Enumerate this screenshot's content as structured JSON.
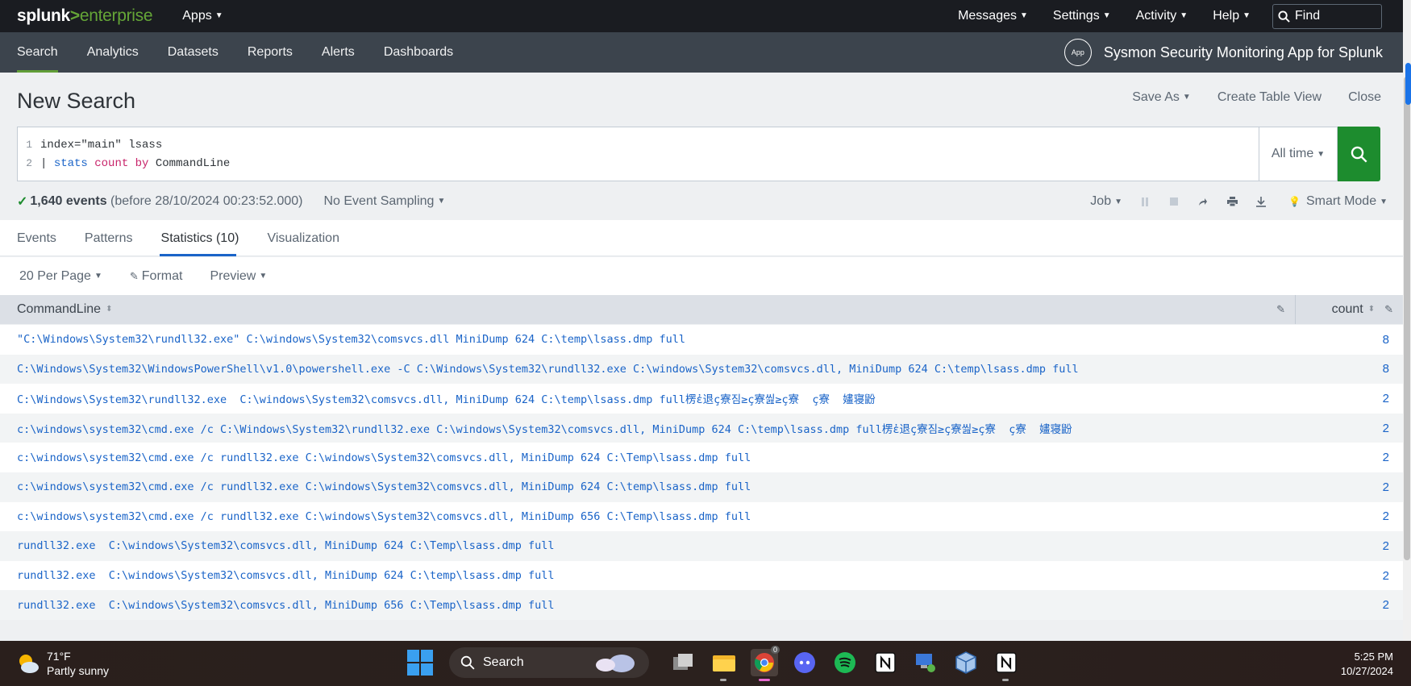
{
  "topbar": {
    "logo_brand": "splunk",
    "logo_sep": ">",
    "logo_product": "enterprise",
    "apps_label": "Apps",
    "links": [
      "Messages",
      "Settings",
      "Activity",
      "Help"
    ],
    "find_placeholder": "Find"
  },
  "appnav": {
    "items": [
      "Search",
      "Analytics",
      "Datasets",
      "Reports",
      "Alerts",
      "Dashboards"
    ],
    "active": "Search",
    "app_icon_text": "App",
    "app_title": "Sysmon Security Monitoring App for Splunk"
  },
  "page": {
    "title": "New Search",
    "actions": {
      "save_as": "Save As",
      "create_table_view": "Create Table View",
      "close": "Close"
    }
  },
  "search": {
    "line1_no": "1",
    "line2_no": "2",
    "line1": "index=\"main\" lsass",
    "line2_pipe": "| ",
    "line2_cmd": "stats",
    "line2_func": "count",
    "line2_by": "by",
    "line2_field": "CommandLine",
    "time_range": "All time"
  },
  "status": {
    "check": "✓",
    "events": "1,640 events",
    "before": "(before 28/10/2024 00:23:52.000)",
    "sampling": "No Event Sampling",
    "job": "Job",
    "mode": "Smart Mode"
  },
  "tabs": {
    "events": "Events",
    "patterns": "Patterns",
    "statistics": "Statistics (10)",
    "visualization": "Visualization"
  },
  "toolbar": {
    "per_page": "20 Per Page",
    "format": "Format",
    "preview": "Preview"
  },
  "table": {
    "col_command": "CommandLine",
    "col_count": "count",
    "rows": [
      {
        "cmd": "\"C:\\Windows\\System32\\rundll32.exe\" C:\\windows\\System32\\comsvcs.dll MiniDump 624 C:\\temp\\lsass.dmp full",
        "count": "8"
      },
      {
        "cmd": "C:\\Windows\\System32\\WindowsPowerShell\\v1.0\\powershell.exe -C C:\\Windows\\System32\\rundll32.exe C:\\windows\\System32\\comsvcs.dll, MiniDump 624 C:\\temp\\lsass.dmp full",
        "count": "8"
      },
      {
        "cmd": "C:\\Windows\\System32\\rundll32.exe  C:\\windows\\System32\\comsvcs.dll, MiniDump 624 C:\\temp\\lsass.dmp full楞ἐ退ç寮짐≥ç寮씶≥ç寮  ç寮  嫿寝鼢",
        "count": "2"
      },
      {
        "cmd": "c:\\windows\\system32\\cmd.exe /c C:\\Windows\\System32\\rundll32.exe C:\\windows\\System32\\comsvcs.dll, MiniDump 624 C:\\temp\\lsass.dmp full楞ἐ退ç寮짐≥ç寮씶≥ç寮  ç寮  嫿寝鼢",
        "count": "2"
      },
      {
        "cmd": "c:\\windows\\system32\\cmd.exe /c rundll32.exe C:\\windows\\System32\\comsvcs.dll, MiniDump 624 C:\\Temp\\lsass.dmp full",
        "count": "2"
      },
      {
        "cmd": "c:\\windows\\system32\\cmd.exe /c rundll32.exe C:\\windows\\System32\\comsvcs.dll, MiniDump 624 C:\\temp\\lsass.dmp full",
        "count": "2"
      },
      {
        "cmd": "c:\\windows\\system32\\cmd.exe /c rundll32.exe C:\\windows\\System32\\comsvcs.dll, MiniDump 656 C:\\Temp\\lsass.dmp full",
        "count": "2"
      },
      {
        "cmd": "rundll32.exe  C:\\windows\\System32\\comsvcs.dll, MiniDump 624 C:\\Temp\\lsass.dmp full",
        "count": "2"
      },
      {
        "cmd": "rundll32.exe  C:\\windows\\System32\\comsvcs.dll, MiniDump 624 C:\\temp\\lsass.dmp full",
        "count": "2"
      },
      {
        "cmd": "rundll32.exe  C:\\windows\\System32\\comsvcs.dll, MiniDump 656 C:\\Temp\\lsass.dmp full",
        "count": "2"
      }
    ]
  },
  "taskbar": {
    "temp": "71°F",
    "weather": "Partly sunny",
    "search_label": "Search",
    "chrome_badge": "0",
    "time": "5:25 PM",
    "date": "10/27/2024"
  },
  "colors": {
    "topbar": "#1a1c21",
    "appnav": "#3c444d",
    "accent_green": "#65a637",
    "link_blue": "#1a64c8",
    "go_button": "#1d8c2e"
  }
}
